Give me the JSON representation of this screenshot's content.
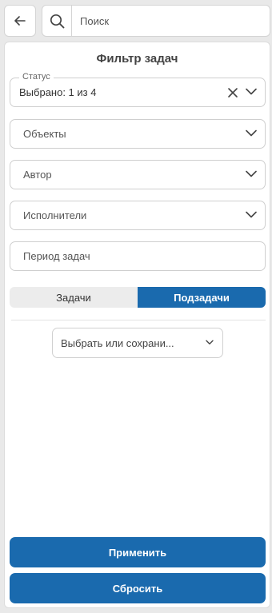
{
  "search": {
    "placeholder": "Поиск"
  },
  "filter": {
    "title": "Фильтр задач",
    "status": {
      "legend": "Статус",
      "value": "Выбрано: 1 из 4"
    },
    "objects": {
      "label": "Объекты"
    },
    "author": {
      "label": "Автор"
    },
    "assignees": {
      "label": "Исполнители"
    },
    "period": {
      "label": "Период задач"
    },
    "tabs": [
      {
        "label": "Задачи",
        "active": false
      },
      {
        "label": "Подзадачи",
        "active": true
      }
    ],
    "preset": {
      "label": "Выбрать или сохрани..."
    },
    "apply_label": "Применить",
    "reset_label": "Сбросить"
  },
  "colors": {
    "accent": "#1a6aae",
    "background": "#e9e9e9"
  },
  "icons": [
    "back-arrow-icon",
    "search-icon",
    "clear-icon",
    "chevron-down-icon"
  ]
}
